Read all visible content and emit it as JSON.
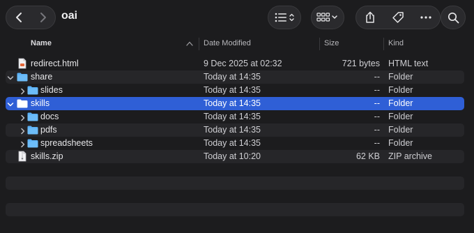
{
  "window": {
    "title": "oai"
  },
  "toolbar": {
    "back_icon": "chevron-left-icon",
    "forward_icon": "chevron-right-icon",
    "view_list_icon": "list-view-icon",
    "view_grid_icon": "grid-view-icon",
    "share_icon": "share-icon",
    "tag_icon": "tag-icon",
    "more_icon": "more-icon",
    "search_icon": "search-icon"
  },
  "columns": {
    "name": "Name",
    "date": "Date Modified",
    "size": "Size",
    "kind": "Kind"
  },
  "files": [
    {
      "name": "redirect.html",
      "date": "9 Dec 2025 at 02:32",
      "size": "721 bytes",
      "kind": "HTML text"
    },
    {
      "name": "share",
      "date": "Today at 14:35",
      "size": "--",
      "kind": "Folder"
    },
    {
      "name": "slides",
      "date": "Today at 14:35",
      "size": "--",
      "kind": "Folder"
    },
    {
      "name": "skills",
      "date": "Today at 14:35",
      "size": "--",
      "kind": "Folder"
    },
    {
      "name": "docs",
      "date": "Today at 14:35",
      "size": "--",
      "kind": "Folder"
    },
    {
      "name": "pdfs",
      "date": "Today at 14:35",
      "size": "--",
      "kind": "Folder"
    },
    {
      "name": "spreadsheets",
      "date": "Today at 14:35",
      "size": "--",
      "kind": "Folder"
    },
    {
      "name": "skills.zip",
      "date": "Today at 10:20",
      "size": "62 KB",
      "kind": "ZIP archive"
    }
  ],
  "colors": {
    "selection": "#2f5fd6",
    "folder": "#5ab0f5"
  }
}
